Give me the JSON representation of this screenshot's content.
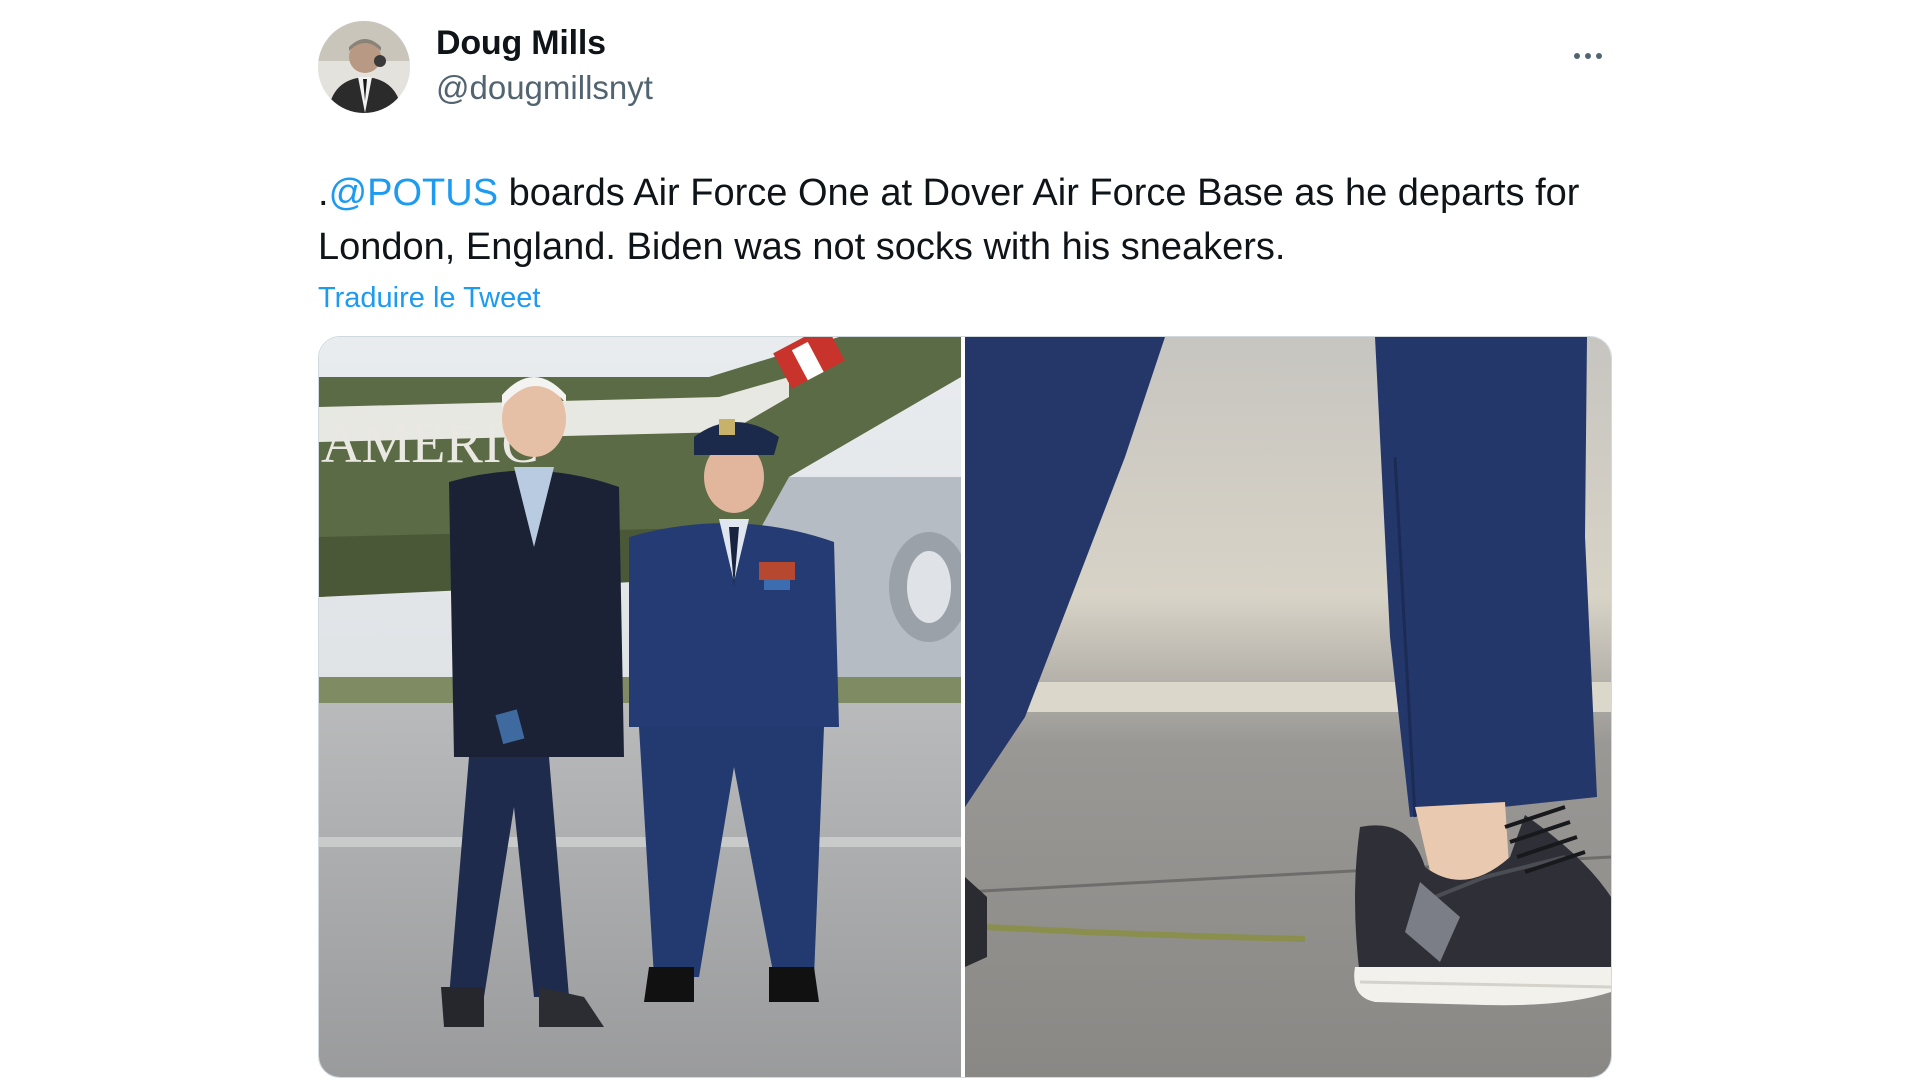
{
  "tweet": {
    "author_name": "Doug Mills",
    "author_handle": "@dougmillsnyt",
    "text_prefix": ".",
    "mention": "@POTUS",
    "text_body": " boards Air Force One at Dover Air Force Base as he departs for London, England. Biden was not socks with his sneakers.",
    "translate_label": "Traduire le Tweet",
    "more_icon": "more-horizontal-icon"
  },
  "media": {
    "count": 2,
    "left_photo_text": "AMERIC"
  },
  "colors": {
    "link": "#1d9bf0",
    "text": "#0f1419",
    "secondary": "#536471",
    "border": "#cfd9de"
  }
}
